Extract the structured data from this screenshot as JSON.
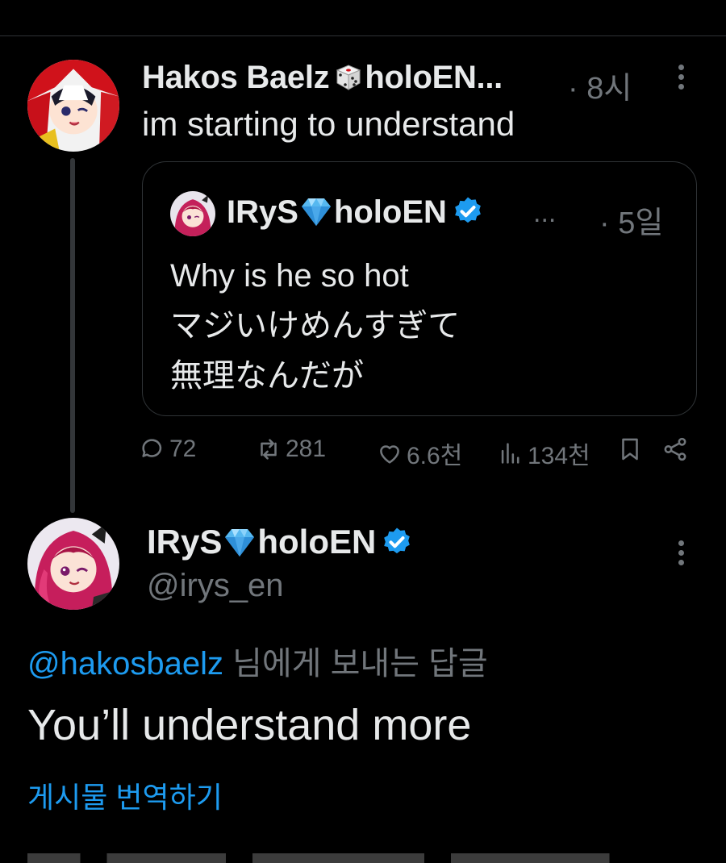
{
  "colors": {
    "background": "#000000",
    "text": "#e7e9ea",
    "muted": "#71767b",
    "accent": "#1d9bf0",
    "border": "#2f3336"
  },
  "icons": [
    "dice-icon",
    "gem-icon",
    "verified-badge-icon",
    "more-vertical-icon",
    "reply-icon",
    "retweet-icon",
    "like-icon",
    "views-icon",
    "bookmark-icon",
    "share-icon"
  ],
  "tweet1": {
    "name_prefix": "Hakos Baelz",
    "name_suffix": "holoEN...",
    "time": "· 8시",
    "text": "im starting to understand",
    "quote": {
      "name_prefix": "IRyS",
      "name_suffix": "holoEN",
      "ellipsis": "...",
      "time": "· 5일",
      "lines": [
        "Why is he so hot",
        "マジいけめんすぎて",
        "無理なんだが"
      ]
    },
    "actions": {
      "replies": "72",
      "retweets": "281",
      "likes": "6.6천",
      "views": "134천"
    }
  },
  "tweet2": {
    "name_prefix": "IRyS",
    "name_suffix": "holoEN",
    "handle": "@irys_en",
    "reply_mention": "@hakosbaelz",
    "reply_suffix": " 님에게 보내는 답글",
    "text": "You’ll understand more",
    "translate_label": "게시물 번역하기"
  }
}
